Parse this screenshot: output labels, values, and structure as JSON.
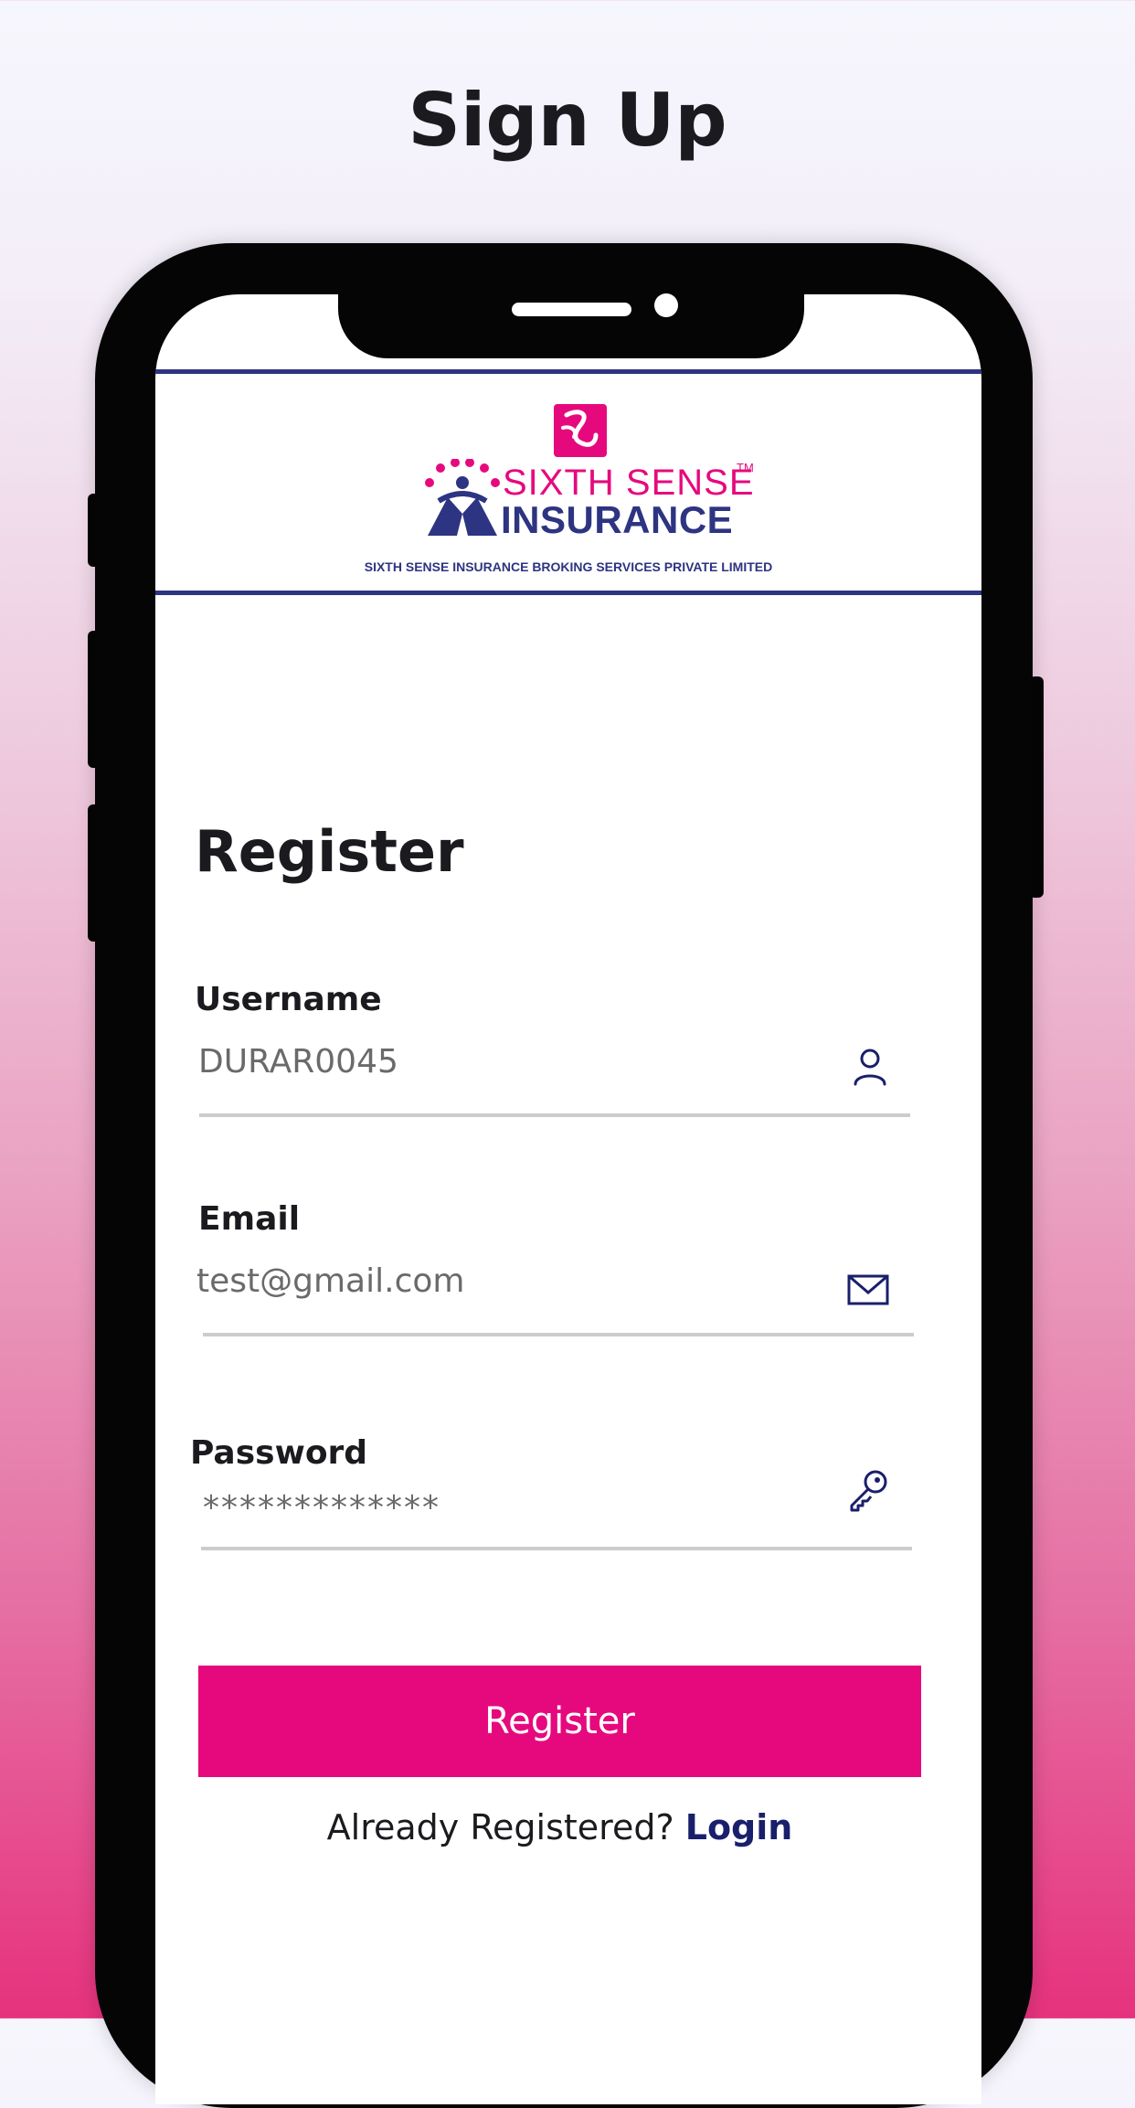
{
  "page": {
    "heading": "Sign Up"
  },
  "brand": {
    "name_line1": "SIXTH SENSE",
    "trademark": "TM",
    "name_line2": "INSURANCE",
    "tagline": "SIXTH SENSE INSURANCE BROKING SERVICES PRIVATE LIMITED",
    "colors": {
      "primary": "#e6097e",
      "secondary": "#2d3481"
    }
  },
  "form": {
    "title": "Register",
    "username": {
      "label": "Username",
      "value": "DURAR0045",
      "icon": "user-icon"
    },
    "email": {
      "label": "Email",
      "value": "test@gmail.com",
      "icon": "envelope-icon"
    },
    "password": {
      "label": "Password",
      "value": "*************",
      "icon": "key-icon"
    },
    "submit_label": "Register",
    "already_text": "Already Registered?",
    "login_label": "Login"
  }
}
